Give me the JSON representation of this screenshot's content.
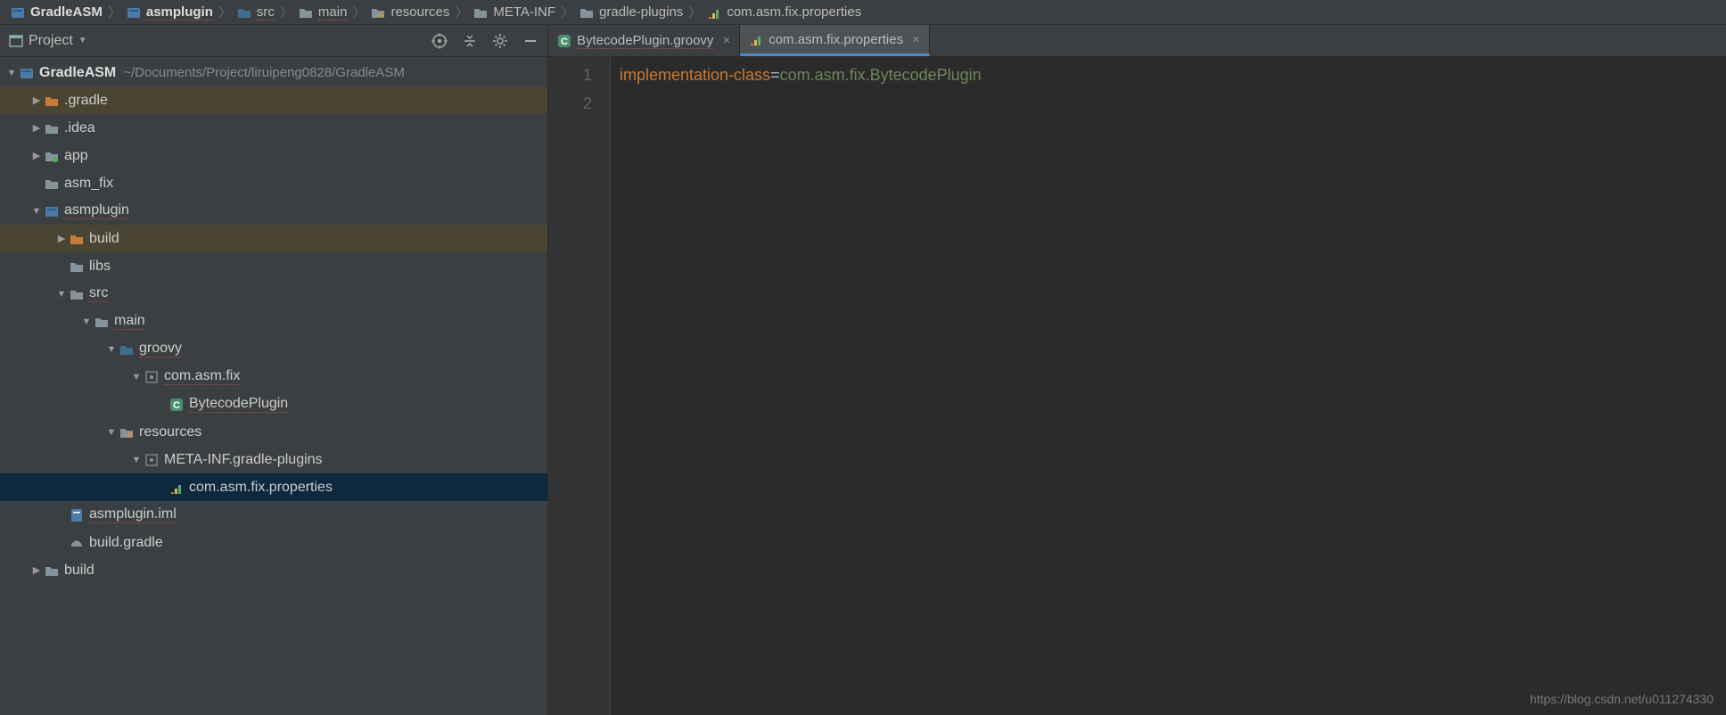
{
  "breadcrumb": [
    {
      "label": "GradleASM",
      "icon": "module",
      "bold": true
    },
    {
      "label": "asmplugin",
      "icon": "module",
      "bold": true,
      "underline": true
    },
    {
      "label": "src",
      "icon": "folder-src",
      "underline": true
    },
    {
      "label": "main",
      "icon": "folder",
      "underline": true
    },
    {
      "label": "resources",
      "icon": "folder-res"
    },
    {
      "label": "META-INF",
      "icon": "folder"
    },
    {
      "label": "gradle-plugins",
      "icon": "folder"
    },
    {
      "label": "com.asm.fix.properties",
      "icon": "props"
    }
  ],
  "sidebar": {
    "title": "Project"
  },
  "tree": {
    "root": {
      "label": "GradleASM",
      "path": "~/Documents/Project/liruipeng0828/GradleASM"
    },
    "items": [
      {
        "indent": 1,
        "arrow": "expand",
        "icon": "folder-orange",
        "label": ".gradle",
        "highlighted": true
      },
      {
        "indent": 1,
        "arrow": "expand",
        "icon": "folder",
        "label": ".idea"
      },
      {
        "indent": 1,
        "arrow": "expand",
        "icon": "folder-dot",
        "label": "app"
      },
      {
        "indent": 1,
        "arrow": "none",
        "icon": "folder",
        "label": "asm_fix"
      },
      {
        "indent": 1,
        "arrow": "collapse",
        "icon": "module",
        "label": "asmplugin",
        "underline": true
      },
      {
        "indent": 2,
        "arrow": "expand",
        "icon": "folder-orange",
        "label": "build",
        "highlighted": true
      },
      {
        "indent": 2,
        "arrow": "none",
        "icon": "folder",
        "label": "libs"
      },
      {
        "indent": 2,
        "arrow": "collapse",
        "icon": "folder",
        "label": "src",
        "underline": true
      },
      {
        "indent": 3,
        "arrow": "collapse",
        "icon": "folder",
        "label": "main",
        "underline": true
      },
      {
        "indent": 4,
        "arrow": "collapse",
        "icon": "folder-src",
        "label": "groovy",
        "underline": true
      },
      {
        "indent": 5,
        "arrow": "collapse",
        "icon": "package",
        "label": "com.asm.fix",
        "underline": true
      },
      {
        "indent": 6,
        "arrow": "none",
        "icon": "class",
        "label": "BytecodePlugin",
        "underline": true
      },
      {
        "indent": 4,
        "arrow": "collapse",
        "icon": "folder-res",
        "label": "resources"
      },
      {
        "indent": 5,
        "arrow": "collapse",
        "icon": "package",
        "label": "META-INF.gradle-plugins"
      },
      {
        "indent": 6,
        "arrow": "none",
        "icon": "props",
        "label": "com.asm.fix.properties",
        "selected": true
      },
      {
        "indent": 2,
        "arrow": "none",
        "icon": "module-file",
        "label": "asmplugin.iml",
        "underline": true
      },
      {
        "indent": 2,
        "arrow": "none",
        "icon": "gradle",
        "label": "build.gradle"
      },
      {
        "indent": 1,
        "arrow": "expand",
        "icon": "folder",
        "label": "build"
      }
    ]
  },
  "tabs": [
    {
      "label": "BytecodePlugin.groovy",
      "icon": "class",
      "active": false,
      "underline": true
    },
    {
      "label": "com.asm.fix.properties",
      "icon": "props",
      "active": true
    }
  ],
  "editor": {
    "lines": [
      "1",
      "2"
    ],
    "content": {
      "key": "implementation-class",
      "eq": "=",
      "val": "com.asm.fix.BytecodePlugin"
    }
  },
  "watermark": "https://blog.csdn.net/u011274330"
}
